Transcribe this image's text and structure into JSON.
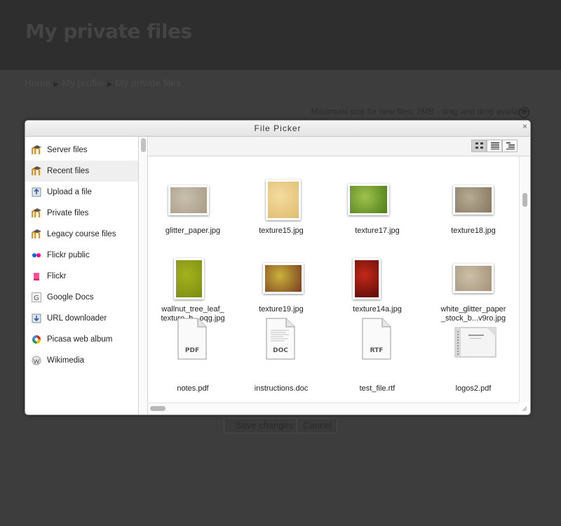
{
  "page": {
    "title": "My private files",
    "breadcrumb": [
      {
        "label": "Home"
      },
      {
        "label": "My profile"
      },
      {
        "label": "My private files"
      }
    ],
    "breadcrumb_sep": "▶",
    "max_size_text": "Maximum size for new files: 2MB - drag and drop available",
    "help_icon": "?",
    "save_label": "Save changes",
    "cancel_label": "Cancel"
  },
  "dialog": {
    "title": "File Picker",
    "close_glyph": "×",
    "repositories": [
      {
        "label": "Server files",
        "icon": "moodle-icon"
      },
      {
        "label": "Recent files",
        "icon": "moodle-icon",
        "active": true
      },
      {
        "label": "Upload a file",
        "icon": "upload-icon"
      },
      {
        "label": "Private files",
        "icon": "moodle-icon"
      },
      {
        "label": "Legacy course files",
        "icon": "moodle-icon"
      },
      {
        "label": "Flickr public",
        "icon": "flickr-icon"
      },
      {
        "label": "Flickr",
        "icon": "flickr-pink-icon"
      },
      {
        "label": "Google Docs",
        "icon": "google-icon"
      },
      {
        "label": "URL downloader",
        "icon": "download-icon"
      },
      {
        "label": "Picasa web album",
        "icon": "picasa-icon"
      },
      {
        "label": "Wikimedia",
        "icon": "wikimedia-icon"
      }
    ],
    "view_modes": [
      {
        "name": "icons-view",
        "active": true
      },
      {
        "name": "details-view",
        "active": false
      },
      {
        "name": "tree-view",
        "active": false
      }
    ],
    "files": [
      {
        "line1": "glitter_paper.jpg",
        "line2": "",
        "kind": "image",
        "colors": [
          "#c9bfae",
          "#a89c87"
        ]
      },
      {
        "line1": "texture15.jpg",
        "line2": "",
        "kind": "image",
        "colors": [
          "#f3dca0",
          "#e0bb6e"
        ]
      },
      {
        "line1": "texture17.jpg",
        "line2": "",
        "kind": "image",
        "colors": [
          "#9fc24a",
          "#4d7d1c"
        ]
      },
      {
        "line1": "texture18.jpg",
        "line2": "",
        "kind": "image",
        "colors": [
          "#b7ab94",
          "#857660"
        ]
      },
      {
        "line1": "wallnut_tree_leaf_",
        "line2": "texture_b...oqg.jpg",
        "kind": "image",
        "colors": [
          "#a3b21c",
          "#7c8c12"
        ]
      },
      {
        "line1": "texture19.jpg",
        "line2": "",
        "kind": "image",
        "colors": [
          "#c9b23a",
          "#7a3b22"
        ]
      },
      {
        "line1": "texture14a.jpg",
        "line2": "",
        "kind": "image",
        "colors": [
          "#c22818",
          "#5c0c0a"
        ]
      },
      {
        "line1": "white_glitter_paper",
        "line2": "_stock_b...v9ro.jpg",
        "kind": "image",
        "colors": [
          "#cdbfa8",
          "#a39279"
        ]
      },
      {
        "line1": "notes.pdf",
        "line2": "",
        "kind": "doc",
        "tag": "PDF"
      },
      {
        "line1": "instructions.doc",
        "line2": "",
        "kind": "doc",
        "tag": "DOC"
      },
      {
        "line1": "test_file.rtf",
        "line2": "",
        "kind": "doc",
        "tag": "RTF"
      },
      {
        "line1": "logos2.pdf",
        "line2": "",
        "kind": "pdf-preview"
      }
    ]
  }
}
